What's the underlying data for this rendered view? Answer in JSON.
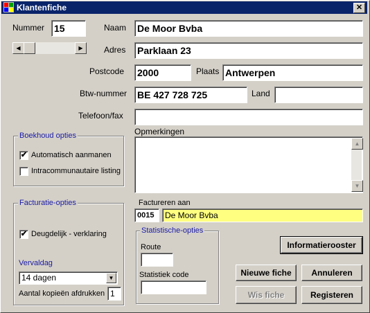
{
  "window": {
    "title": "Klantenfiche",
    "close_glyph": "✕"
  },
  "fields": {
    "nummer_label": "Nummer",
    "nummer_value": "15",
    "naam_label": "Naam",
    "naam_value": "De Moor Bvba",
    "adres_label": "Adres",
    "adres_value": "Parklaan 23",
    "postcode_label": "Postcode",
    "postcode_value": "2000",
    "plaats_label": "Plaats",
    "plaats_value": "Antwerpen",
    "btw_label": "Btw-nummer",
    "btw_value": "BE 427 728 725",
    "land_label": "Land",
    "land_value": "",
    "telefoon_label": "Telefoon/fax",
    "telefoon_value": "",
    "opmerkingen_label": "Opmerkingen",
    "opmerkingen_value": ""
  },
  "boekhoud": {
    "title": "Boekhoud opties",
    "auto_aanmanen_label": "Automatisch aanmanen",
    "auto_aanmanen_checked": "✔",
    "intra_label": "Intracommunautaire listing",
    "intra_checked": ""
  },
  "facturatie": {
    "title": "Facturatie-opties",
    "deugdelijk_label": "Deugdelijk - verklaring",
    "deugdelijk_checked": "✔",
    "vervaldag_label": "Vervaldag",
    "vervaldag_value": "14 dagen",
    "kopieen_label": "Aantal kopieën afdrukken",
    "kopieen_value": "1"
  },
  "factureren": {
    "label": "Factureren aan",
    "code": "0015",
    "name": "De Moor Bvba"
  },
  "statistische": {
    "title": "Statistische-opties",
    "route_label": "Route",
    "route_value": "",
    "statcode_label": "Statistiek code",
    "statcode_value": ""
  },
  "buttons": {
    "informatierooster": "Informatierooster",
    "nieuwe_fiche": "Nieuwe fiche",
    "annuleren": "Annuleren",
    "wis_fiche": "Wis fiche",
    "registeren": "Registeren"
  },
  "colors": {
    "titlebar": "#0a246a",
    "group_title": "#1a1aa6",
    "highlight_field": "#ffff80"
  }
}
